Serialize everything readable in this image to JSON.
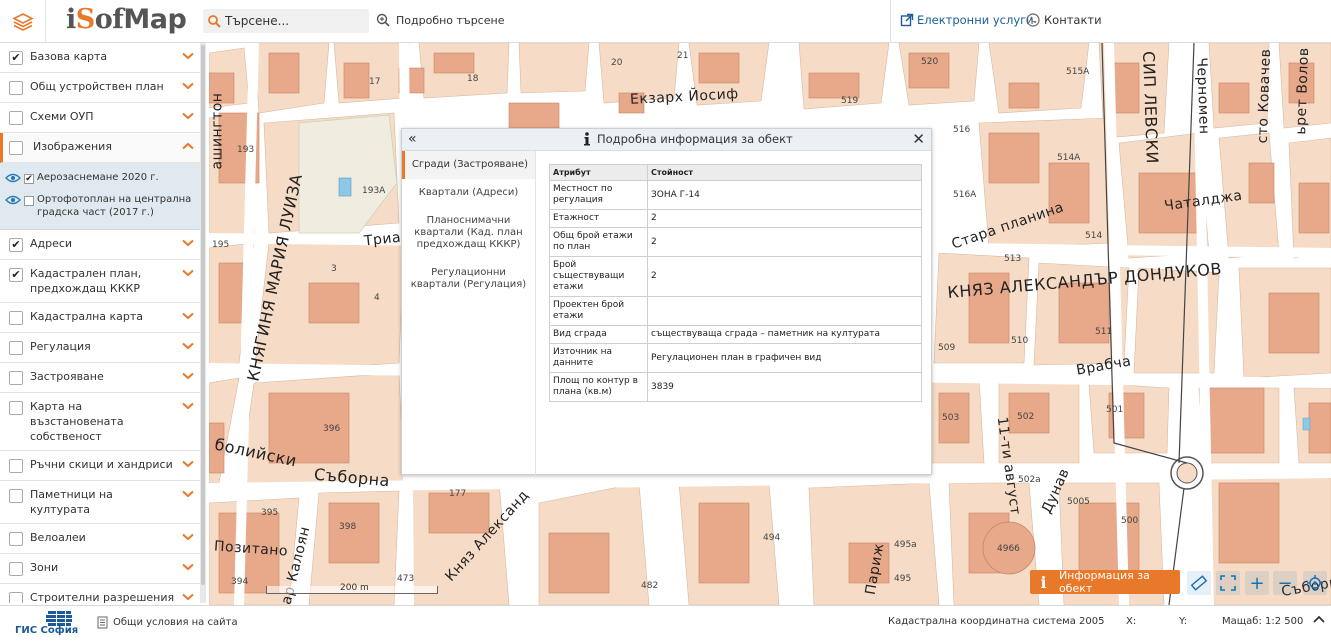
{
  "header": {
    "logo": {
      "prefix": "i",
      "o": "S",
      "rest": "of",
      "map": "Map"
    },
    "search_placeholder": "Търсене...",
    "advanced_search": "Подробно търсене",
    "eservices": "Електронни услуги",
    "contacts": "Контакти"
  },
  "sidebar": {
    "layers": [
      {
        "label": "Базова карта",
        "checked": true
      },
      {
        "label": "Общ устройствен план",
        "checked": false
      },
      {
        "label": "Схеми ОУП",
        "checked": false
      },
      {
        "label": "Изображения",
        "checked": false,
        "expanded": true
      },
      {
        "label": "Адреси",
        "checked": true
      },
      {
        "label": "Кадастрален план, предхождащ КККР",
        "checked": true
      },
      {
        "label": "Кадастрална карта",
        "checked": false
      },
      {
        "label": "Регулация",
        "checked": false
      },
      {
        "label": "Застрояване",
        "checked": false
      },
      {
        "label": "Карта на възстановената собственост",
        "checked": false
      },
      {
        "label": "Ръчни скици и хандриси",
        "checked": false
      },
      {
        "label": "Паметници на културата",
        "checked": false
      },
      {
        "label": "Велоалеи",
        "checked": false
      },
      {
        "label": "Зони",
        "checked": false
      },
      {
        "label": "Строителни разрешения",
        "checked": false
      }
    ],
    "images_sublayers": [
      {
        "label": "Аерозаснемане 2020 г.",
        "checked": true
      },
      {
        "label": "Ортофотоплан на централна градска част (2017 г.)",
        "checked": false
      }
    ]
  },
  "map": {
    "streets": {
      "exarh": "Екзарх Йосиф",
      "stara": "Стара планина",
      "dondukov": "КНЯЗ АЛЕКСАНДЪР ДОНДУКОВ",
      "chataldzha": "Чаталджа",
      "vrabcha": "Врабча",
      "avgust": "11-ти август",
      "dunav": "Дунав",
      "pariz": "Париж",
      "knyaz": "Княз Александ",
      "saborna": "Съборна",
      "bolijski": "болийски",
      "pozitano": "Позитано",
      "tsar": "Цар Калоян",
      "knyaginya": "КНЯГИНЯ МАРИЯ ЛУИЗА",
      "vashington": "ашингтон",
      "triad": "Триад",
      "levski": "СИП ЛЕВСКИ",
      "chernomen": "Черномен",
      "kovachev": "сто Ковачев",
      "volov": "ьрет Волов",
      "saborishte": "Събориш"
    },
    "building_numbers": [
      "17",
      "18",
      "20",
      "21",
      "520",
      "515А",
      "519",
      "193",
      "193А",
      "516",
      "514А",
      "195",
      "516А",
      "514",
      "513",
      "3",
      "4",
      "509",
      "510",
      "511",
      "503",
      "502",
      "501",
      "396",
      "502а",
      "5005",
      "500",
      "395",
      "398",
      "494",
      "495а",
      "4966",
      "495",
      "482",
      "394",
      "473",
      "177"
    ],
    "scale_label": "200 m"
  },
  "popup": {
    "title": "Подробна информация за обект",
    "tabs": [
      "Сгради (Застрояване)",
      "Квартали (Адреси)",
      "Планоснимачни квартали (Кад. план предхождащ КККР)",
      "Регулационни квартали (Регулация)"
    ],
    "table": {
      "headers": [
        "Атрибут",
        "Стойност"
      ],
      "rows": [
        [
          "Местност по регулация",
          "ЗОНА Г-14"
        ],
        [
          "Етажност",
          "2"
        ],
        [
          "Общ брой етажи по план",
          "2"
        ],
        [
          "Брой съществуващи етажи",
          "2"
        ],
        [
          "Проектен брой етажи",
          ""
        ],
        [
          "Вид сграда",
          "съществуваща сграда – паметник на културата"
        ],
        [
          "Източник на данните",
          "Регулационен план в графичен вид"
        ],
        [
          "Площ по контур в плана (кв.м)",
          "3839"
        ]
      ]
    }
  },
  "controls": {
    "info_button": "Информация за обект"
  },
  "footer": {
    "gis": "ГИС София",
    "terms": "Общи условия на сайта",
    "coord_system": "Кадастрална координатна система 2005",
    "x_label": "X:",
    "y_label": "Y:",
    "scale": "Мащаб: 1:2 500"
  },
  "colors": {
    "accent": "#e8782a",
    "link": "#1a5e9a",
    "building": "#e8a98a",
    "block": "#f6d9c2"
  }
}
